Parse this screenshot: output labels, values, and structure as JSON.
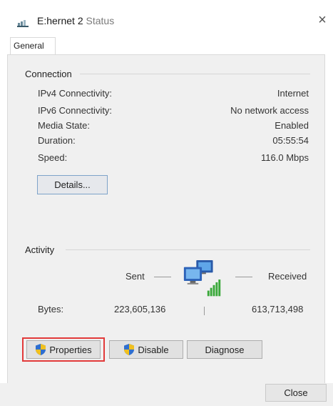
{
  "window": {
    "title_primary": "E:hernet 2",
    "title_secondary": "Status",
    "close_glyph": "×",
    "icon": "network-adapter-icon"
  },
  "tabs": [
    {
      "label": "General",
      "selected": true
    }
  ],
  "connection": {
    "heading": "Connection",
    "rows": [
      {
        "label": "IPv4 Connectivity:",
        "value": "Internet"
      },
      {
        "label": "IPv6 Connectivity:",
        "value": "No network access"
      },
      {
        "label": "Media State:",
        "value": "Enabled"
      },
      {
        "label": "Duration:",
        "value": "05:55:54"
      },
      {
        "label": "Speed:",
        "value": "116.0 Mbps"
      }
    ],
    "details_button": "Details..."
  },
  "activity": {
    "heading": "Activity",
    "sent_label": "Sent",
    "received_label": "Received",
    "bytes_label": "Bytes:",
    "bytes_sent": "223,605,136",
    "bytes_received": "613,713,498",
    "icon": "network-computers-icon"
  },
  "buttons": {
    "properties": "Properties",
    "disable": "Disable",
    "diagnose": "Diagnose",
    "close": "Close"
  },
  "colors": {
    "highlight_outline": "#e23a3a",
    "panel_bg": "#f0f0f0",
    "shield_blue": "#2f6fd0",
    "shield_yellow": "#f0c020",
    "signal_green": "#3aa83a"
  }
}
